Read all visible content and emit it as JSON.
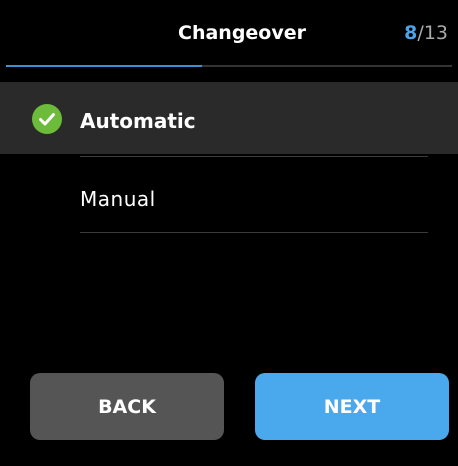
{
  "header": {
    "title": "Changeover",
    "step_current": "8",
    "step_separator": "/",
    "step_total": "13",
    "progress_fraction": 0.44
  },
  "options": [
    {
      "label": "Automatic",
      "selected": true,
      "icon": "check-circle-icon"
    },
    {
      "label": "Manual",
      "selected": false
    }
  ],
  "buttons": {
    "back_label": "BACK",
    "next_label": "NEXT"
  },
  "colors": {
    "accent": "#4aa8ec",
    "check": "#6dbb3a",
    "background": "#000000",
    "selected_row": "#2a2a2a",
    "back_button": "#555555"
  }
}
